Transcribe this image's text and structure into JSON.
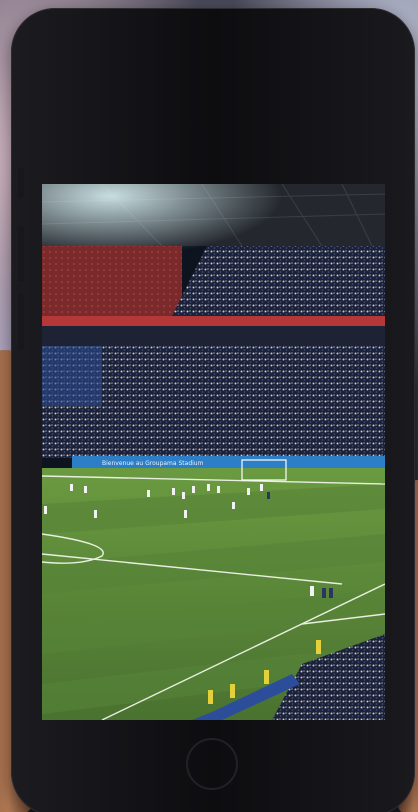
{
  "scene": {
    "subject": "smartphone showing a photo of a football stadium",
    "colors": {
      "phone_body": "#111114",
      "pitch_light": "#5f8a3a",
      "pitch_dark": "#4c7430",
      "stands": "#1f2a44",
      "roof": "#2a2e35",
      "banner": "#2c7fc7"
    }
  },
  "stadium": {
    "banner_text": "Bienvenue au Groupama Stadium"
  }
}
